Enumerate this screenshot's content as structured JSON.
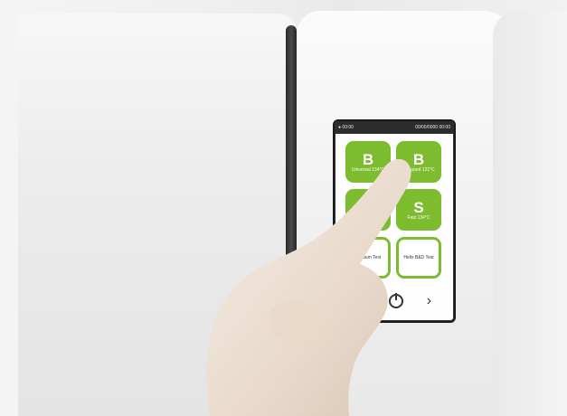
{
  "screen": {
    "status_left": "● 00:00",
    "status_right": "00/00/0000 00:00",
    "tiles": [
      {
        "letter": "B",
        "label": "Universal 134°C"
      },
      {
        "letter": "B",
        "label": "Wrapped 121°C"
      },
      {
        "letter": "",
        "label": ""
      },
      {
        "letter": "S",
        "label": "Fast 134°C"
      },
      {
        "letter": "",
        "label": "Vacuum Test"
      },
      {
        "letter": "",
        "label": "Helix B&D Test"
      }
    ],
    "nav": {
      "menu": "≡",
      "next": "›"
    }
  },
  "colors": {
    "tile_green": "#7dbb2f",
    "screen_bezel": "#1a1a1a",
    "status_bar": "#2c2c2c"
  }
}
